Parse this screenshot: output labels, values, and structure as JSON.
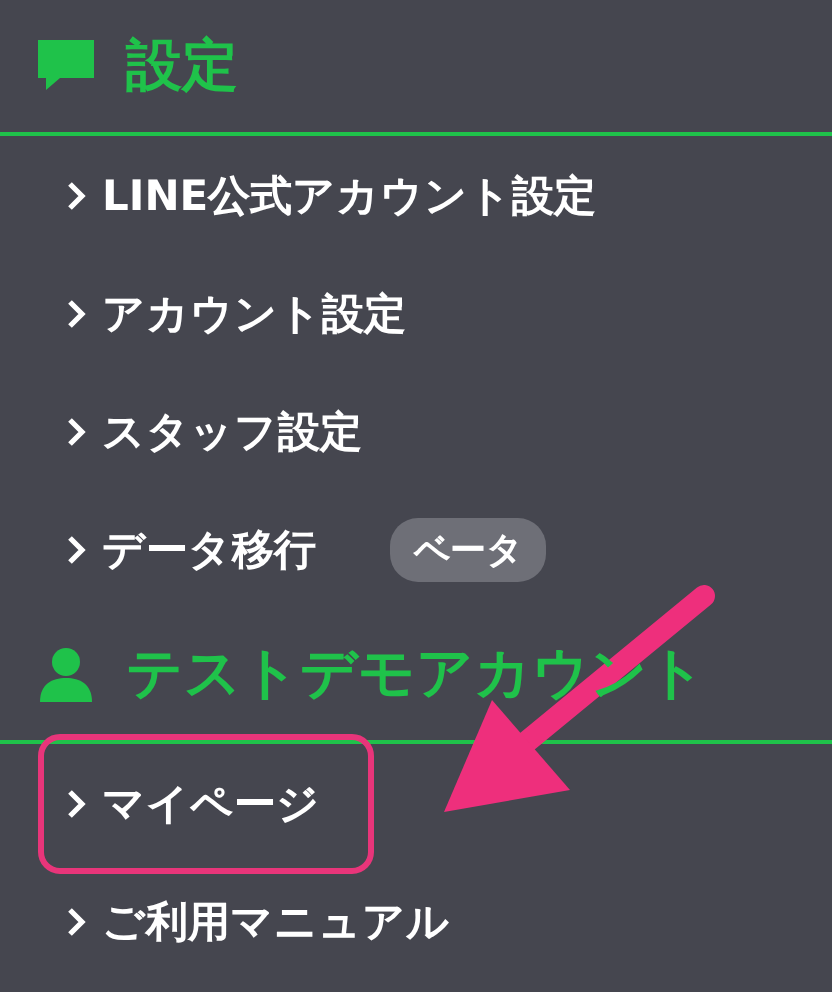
{
  "sections": [
    {
      "title": "設定",
      "items": [
        {
          "label": "LINE公式アカウント設定",
          "highlighted": false
        },
        {
          "label": "アカウント設定",
          "highlighted": false
        },
        {
          "label": "スタッフ設定",
          "highlighted": false
        },
        {
          "label": "データ移行",
          "badge": "ベータ",
          "highlighted": false
        }
      ]
    },
    {
      "title": "テストデモアカウント",
      "items": [
        {
          "label": "マイページ",
          "highlighted": true
        },
        {
          "label": "ご利用マニュアル",
          "highlighted": false
        }
      ]
    }
  ],
  "annotation": {
    "kind": "arrow"
  }
}
